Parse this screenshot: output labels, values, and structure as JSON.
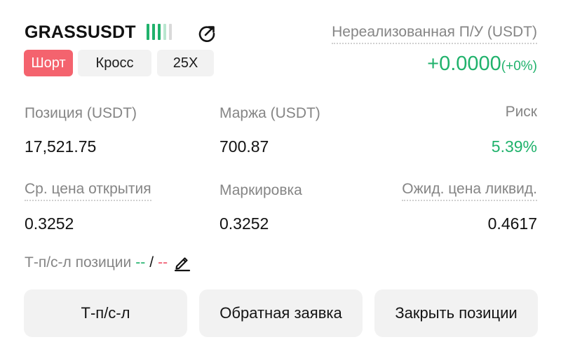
{
  "header": {
    "symbol": "GRASSUSDT",
    "bar_colors": [
      "#20b26c",
      "#20b26c",
      "#20b26c",
      "#b9e6cf",
      "#d9d9d9"
    ],
    "share_icon": "share-icon",
    "side": "Шорт",
    "margin_mode": "Кросс",
    "leverage": "25X"
  },
  "pnl": {
    "label": "Нереализованная П/У (USDT)",
    "value": "+0.0000",
    "percent": "(+0%)"
  },
  "stats_row1": {
    "position_label": "Позиция (USDT)",
    "position_value": "17,521.75",
    "margin_label": "Маржа (USDT)",
    "margin_value": "700.87",
    "risk_label": "Риск",
    "risk_value": "5.39%"
  },
  "stats_row2": {
    "entry_label": "Ср. цена открытия",
    "entry_value": "0.3252",
    "mark_label": "Маркировка",
    "mark_value": "0.3252",
    "liq_label": "Ожид. цена ликвид.",
    "liq_value": "0.4617"
  },
  "tpsl": {
    "label": "Т-п/с-л позиции",
    "tp_value": "--",
    "separator": "/",
    "sl_value": "--",
    "edit_icon": "pencil-icon"
  },
  "buttons": {
    "tpsl": "Т-п/с-л",
    "reverse": "Обратная заявка",
    "close": "Закрыть позиции"
  },
  "colors": {
    "green": "#20b26c",
    "red": "#f0556b",
    "short_tag_bg": "#f4636e",
    "tag_bg": "#f2f2f2"
  }
}
